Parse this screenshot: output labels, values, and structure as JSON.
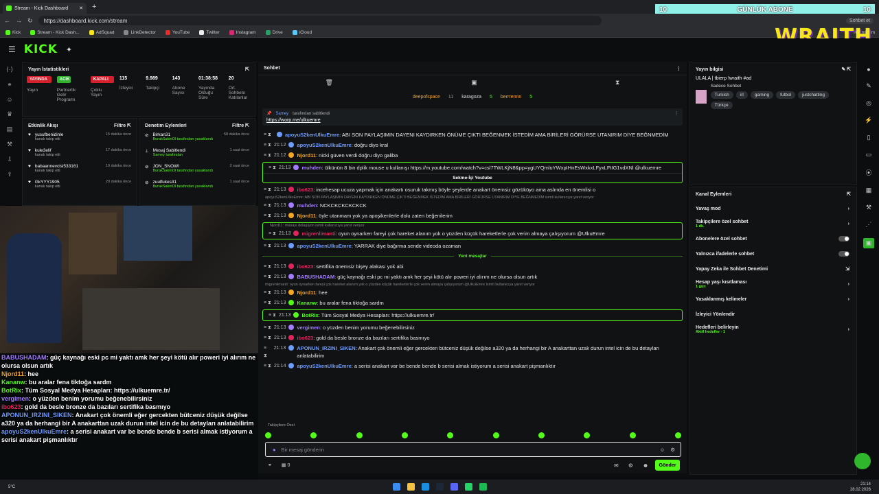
{
  "browser": {
    "tabs": [
      {
        "label": "Stream - Kick Dashboard"
      },
      {
        "label": "+"
      }
    ],
    "url": "https://dashboard.kick.com/stream",
    "bookmarks": [
      "Kick",
      "Stream - Kick Dash...",
      "AdSquad",
      "LinkDetector",
      "YouTube",
      "Twitter",
      "Instagram",
      "Drive",
      "iCloud"
    ],
    "profile": "Sohbet et",
    "bookmarks_right": "Yer imlerim"
  },
  "overlay_top": {
    "left_num": "10",
    "label": "GÜNLÜK ABONE",
    "right_num": "10",
    "wraith": "WRAITH"
  },
  "nav": {
    "logo": "KICK"
  },
  "stats": {
    "title": "Yayın İstatistikleri",
    "badges": [
      {
        "label": "YAYINDA",
        "color": "#d4202a",
        "caption": "Yayın"
      },
      {
        "label": "ACIK",
        "color": "#2fb62d",
        "caption": "Partnerlik Gelir Programı"
      },
      {
        "label": "KAPALI",
        "color": "#d4202a",
        "caption": "Çoklu Yayın"
      }
    ],
    "numbers": [
      {
        "value": "115",
        "label": "İzleyici"
      },
      {
        "value": "9.989",
        "label": "Takipçi"
      },
      {
        "value": "143",
        "label": "Abone Sayısı"
      },
      {
        "value": "01:38:58",
        "label": "Yayında Olduğu Süre"
      },
      {
        "value": "20",
        "label": "Ort. Sohbete Katılanlar"
      }
    ]
  },
  "activity": {
    "title": "Etkinlik Akışı",
    "filter": "Filtre",
    "items": [
      {
        "user": "yusufbenidinle",
        "sub": "kanalı takip etti",
        "ago": "15 dakika önce"
      },
      {
        "user": "kule3elif",
        "sub": "kanalı takip etti",
        "ago": "17 dakika önce"
      },
      {
        "user": "babaannevcisi533161",
        "sub": "kanalı takip etti",
        "ago": "19 dakika önce"
      },
      {
        "user": "GkYYY1905",
        "sub": "kanalı takip etti",
        "ago": "20 dakika önce"
      }
    ]
  },
  "moderation": {
    "title": "Denetim Eylemleri",
    "filter": "Filtre",
    "items": [
      {
        "user": "Birkan31",
        "sub": "BurakSakinOl tarafından yasaklandı",
        "ago": "58 dakika önce"
      },
      {
        "user": "Mesaj Sabitlendi",
        "sub": "Samey tarafından",
        "ago": "1 saat önce"
      },
      {
        "user": "JON_SNOWI",
        "sub": "BurakSakinOl tarafından yasaklandı",
        "ago": "2 saat önce"
      },
      {
        "user": "zuulfukes31",
        "sub": "BurakSakinOl tarafından yasaklandı",
        "ago": "1 saat önce"
      }
    ]
  },
  "chat": {
    "title": "Sohbet",
    "leaderboard": [
      {
        "name": "deepofspace",
        "count": "11"
      },
      {
        "name": "karagoza",
        "count": "5"
      },
      {
        "name": "berrrennn",
        "count": "5"
      }
    ],
    "pinned": {
      "by": "Samey",
      "by_text": "tarafından sabitlendi",
      "link": "https://worp.me/ulkuemre"
    },
    "messages": [
      {
        "time": "",
        "user": "apoyuS2kenUlkuEmre",
        "color": "#6f9cff",
        "text": "ABI SON PAYLAŞIMIN DAYENI KAYDIRKEN ÖNÜME ÇIKTI BEĞENMEK İSTEDİM AMA BİRİLERİ GÖRÜRSE UTANIRIM DİYE BEĞNMEDİM"
      },
      {
        "time": "21:12",
        "user": "apoyuS2kenUlkuEmre",
        "color": "#6f9cff",
        "text": "doğru diyo kral"
      },
      {
        "time": "21:12",
        "user": "Njord11",
        "color": "#f5a623",
        "text": "nicki güven verdi doğru diyo galiba"
      },
      {
        "time": "21:13",
        "user": "muhden",
        "color": "#a37cff",
        "text": "ülkünün 8 bin dplik mouse u kullanışı https://m.youtube.com/watch?v=csl7TWLKjN8&pp=ygUYQmluYWxpIHnEsWxkxLFyxLFtIG1vdXNl @ulkuemre",
        "highlight": true,
        "embed": "Sekme-İçi Youtube"
      },
      {
        "time": "21:13",
        "user": "ibo623",
        "color": "#e0245e",
        "text": "incehesap ucuza yapmak için anakartı osuruk takmış böyle şeylerde anakart önemsiz gözüküyo ama aslında en önemlisi o"
      },
      {
        "reply": "apoyuS2kenUlkuEmre: ABI SON PAYLAŞIMIN DAYENI KAYDIRKEN ÖNÜME ÇIKTI BEĞENMEK İSTEDİM AMA BİRİLERİ GÖRÜRSE UTANIRIM DİYE BEĞNMEDİM isimli kullanıcıya yanıt veriyor",
        "time": "21:13",
        "user": "muhden",
        "color": "#a37cff",
        "text": "NCKCKCKCKCKCK"
      },
      {
        "time": "21:13",
        "user": "Njord11",
        "color": "#f5a623",
        "text": "öyle utanmam yok ya apoşikenlerle dolu zaten beğenilerim"
      },
      {
        "reply": "Njord11: masayı dolaşıyon isimli kullanıcıya yanıt veriyor",
        "time": "21:13",
        "user": "migrenlimanti",
        "color": "#e0245e",
        "text": "oyun oynarken fareyi çok hareket alanım yok o yüzden küçük hareketlerle çok verim almaya çalışıyorum @UlkuEmre",
        "highlight": true
      },
      {
        "time": "21:13",
        "user": "apoyuS2kenUlkuEmre",
        "color": "#6f9cff",
        "text": "YARRAK diye bağırma sende videoda ozaman"
      }
    ],
    "new_label": "Yeni mesajlar",
    "messages2": [
      {
        "time": "21:13",
        "user": "ibo623",
        "color": "#e0245e",
        "text": "sertifika önemsiz bişey alakası yok abi"
      },
      {
        "time": "21:13",
        "user": "BABUSHADAM",
        "color": "#a37cff",
        "text": "güç kaynağı eski pc mi yaktı amk her şeyi kötü alır poweri iyi alırım ne olursa olsun artık"
      },
      {
        "reply": "migrenlimanti: oyun oynarken fareyi çok hareket alanım yok o yüzden küçük hareketlerle çok verim almaya çalışıyorum @UlkuEmre isimli kullanıcıya yanıt veriyor",
        "time": "21:13",
        "user": "Njord11",
        "color": "#f5a623",
        "text": "hee"
      },
      {
        "time": "21:13",
        "user": "Kananw",
        "color": "#53fc18",
        "text": "bu aralar fena tiktoğa sardm"
      },
      {
        "time": "21:13",
        "user": "BotRix",
        "color": "#53fc18",
        "text": "Tüm Sosyal Medya Hesapları: https://ulkuemre.tr/",
        "highlight": true
      },
      {
        "time": "21:13",
        "user": "vergimen",
        "color": "#a37cff",
        "text": "o yüzden benim yorumu beğenebilirsiniz"
      },
      {
        "time": "21:13",
        "user": "ibo623",
        "color": "#e0245e",
        "text": "gold da besle bronze da bazıları sertifika basmıyo"
      },
      {
        "time": "21:13",
        "user": "APONUN_IRZINI_SIKEN",
        "color": "#6f9cff",
        "text": "Anakart çok önemli eğer gercekten bütceniz düşük değilse a320 ya da herhangi bir A anakarttan uzak durun intel icin de bu detayları anlatabilirim"
      },
      {
        "time": "21:14",
        "user": "apoyuS2kenUlkuEmre",
        "color": "#6f9cff",
        "text": "a serisi anakart var be bende bende b serisi almak istiyorum a serisi anakart pişmanlıktır"
      }
    ],
    "followers_label": "Takipçilere Özel",
    "input_placeholder": "Bir mesaj gönderin",
    "send": "Gönder",
    "count": "0"
  },
  "stream_info": {
    "title": "Yayın bilgisi",
    "stream_title": "ULALA | tbierp !wraith #ad",
    "category": "Sadece Sohbet",
    "tags": [
      "Turkish",
      "irl",
      "gaming",
      "futbol",
      "justchatting",
      "Türkçe"
    ]
  },
  "channel_actions": {
    "title": "Kanal Eylemleri",
    "items": [
      {
        "label": "Yavaş mod",
        "type": "arrow"
      },
      {
        "label": "Takipçilere özel sohbet",
        "sub": "1 dk.",
        "type": "arrow"
      },
      {
        "label": "Abonelere özel sohbet",
        "type": "toggle"
      },
      {
        "label": "Yalnızca ifadelerle sohbet",
        "type": "toggle"
      },
      {
        "label": "Yapay Zeka ile Sohbet Denetimi",
        "type": "link"
      },
      {
        "label": "Hesap yaşı kısıtlaması",
        "sub": "1 gün",
        "type": "arrow"
      },
      {
        "label": "Yasaklanmış kelimeler",
        "type": "arrow"
      },
      {
        "label": "İzleyici Yönlendir",
        "type": "none"
      },
      {
        "label": "Hedefleri belirleyin",
        "sub": "Aktif hedefler - 1",
        "type": "arrow"
      }
    ]
  },
  "cam_overlay": [
    {
      "user": "BABUSHADAM",
      "color": "#a37cff",
      "text": "güç kaynağı eski pc mi yaktı amk her şeyi kötü alır poweri iyi alırım ne olursa olsun artık"
    },
    {
      "user": "Njord11",
      "color": "#f5a623",
      "text": "hee"
    },
    {
      "user": "Kananw",
      "color": "#53fc18",
      "text": "bu aralar fena tiktoğa sardm"
    },
    {
      "user": "BotRix",
      "color": "#53fc18",
      "text": "Tüm Sosyal Medya Hesapları: https://ulkuemre.tr/"
    },
    {
      "user": "vergimen",
      "color": "#a37cff",
      "text": "o yüzden benim yorumu beğenebilirsiniz"
    },
    {
      "user": "ibo623",
      "color": "#e0245e",
      "text": "gold da besle bronze da bazıları sertifika basmıyo"
    },
    {
      "user": "APONUN_IRZINI_SIKEN",
      "color": "#6f9cff",
      "text": "Anakart çok önemli eğer gercekten bütceniz düşük değilse a320 ya da herhangi bir A anakarttan uzak durun intel icin de bu detayları anlatabilirim"
    },
    {
      "user": "apoyuS2kenUlkuEmre",
      "color": "#6f9cff",
      "text": "a serisi anakart var be bende bende b serisi almak istiyorum a serisi anakart pişmanlıktır"
    }
  ],
  "taskbar": {
    "time": "21:14",
    "date": "28.02.2026",
    "weather": "5°C"
  }
}
